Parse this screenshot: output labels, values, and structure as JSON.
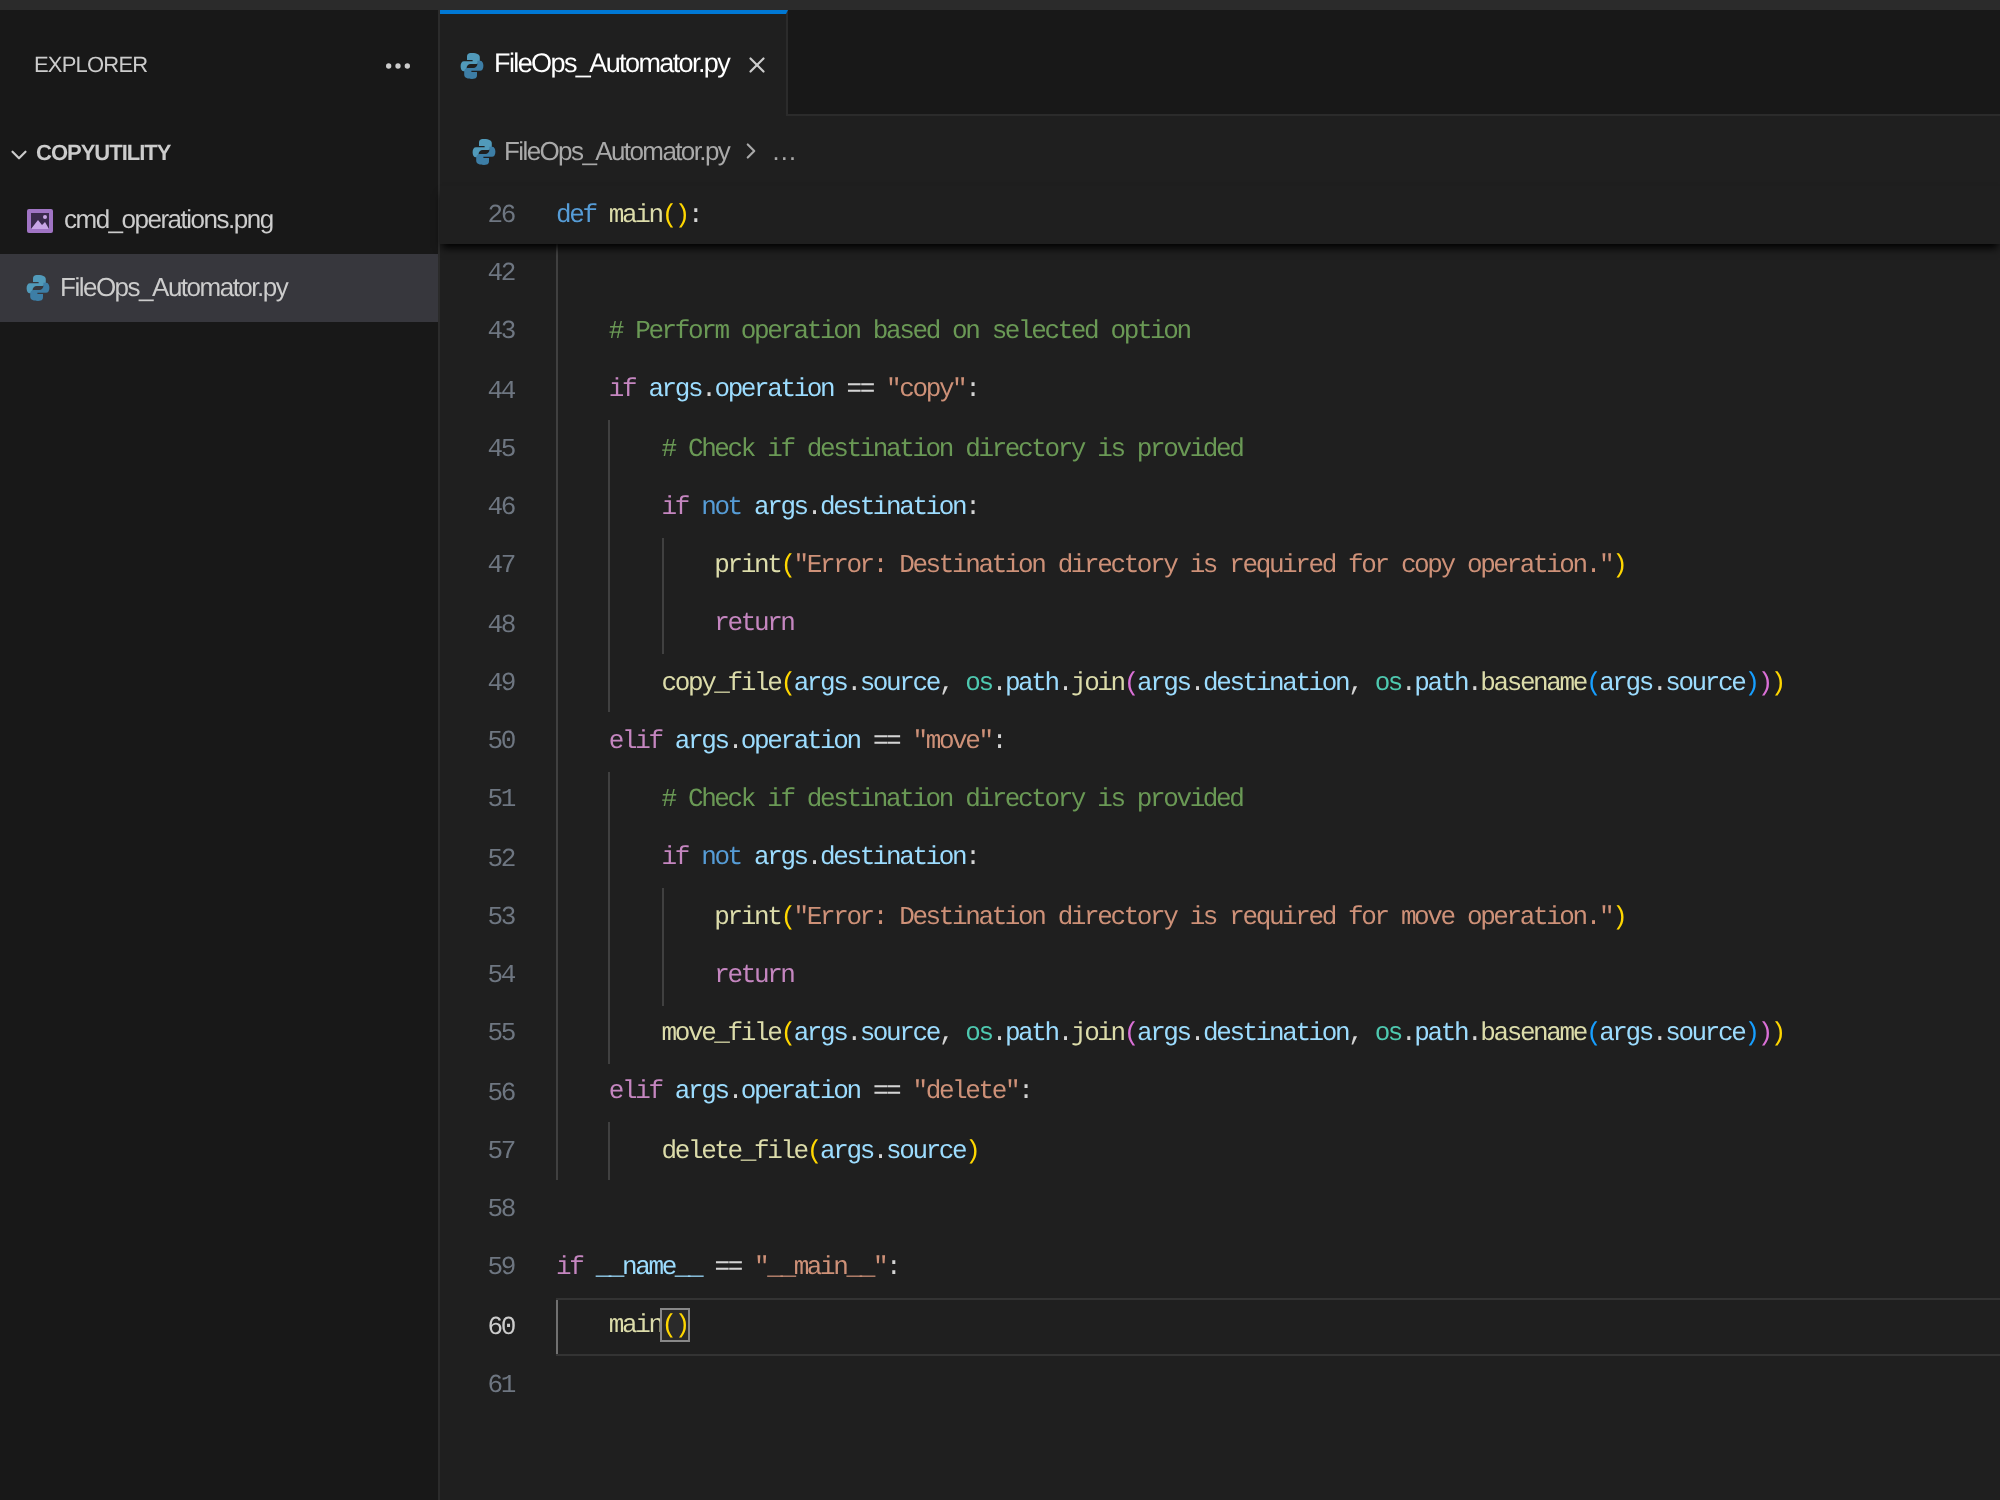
{
  "sidebar": {
    "title": "EXPLORER",
    "folder": {
      "name": "COPYUTILITY",
      "expanded": true,
      "children": [
        {
          "name": "cmd_operations.png",
          "kind": "image",
          "selected": false
        },
        {
          "name": "FileOps_Automator.py",
          "kind": "python",
          "selected": true
        }
      ]
    }
  },
  "tabs": [
    {
      "label": "FileOps_Automator.py",
      "kind": "python",
      "selected": true
    }
  ],
  "breadcrumb": {
    "file": "FileOps_Automator.py",
    "kind": "python",
    "more": "…"
  },
  "editor": {
    "sticky_line": {
      "number": "26",
      "active": false,
      "tokens": [
        {
          "kind": "storage",
          "text": "def "
        },
        {
          "kind": "function",
          "text": "main"
        },
        {
          "kind": "bracket1",
          "text": "()"
        },
        {
          "kind": "plain",
          "text": ":"
        }
      ],
      "children": [
        {
          "number": "42",
          "active": false
        },
        {
          "number": "43",
          "active": false,
          "tokens": [
            {
              "kind": "comment",
              "text": "# Perform operation based on selected option"
            }
          ]
        },
        {
          "number": "44",
          "active": false,
          "tokens": [
            {
              "kind": "keyword",
              "text": "if "
            },
            {
              "kind": "variable",
              "text": "args"
            },
            {
              "kind": "plain",
              "text": "."
            },
            {
              "kind": "variable",
              "text": "operation"
            },
            {
              "kind": "plain",
              "text": " == "
            },
            {
              "kind": "string",
              "text": "\"copy\""
            },
            {
              "kind": "plain",
              "text": ":"
            }
          ],
          "children": [
            {
              "number": "45",
              "active": false,
              "tokens": [
                {
                  "kind": "comment",
                  "text": "# Check if destination directory is provided"
                }
              ]
            },
            {
              "number": "46",
              "active": false,
              "tokens": [
                {
                  "kind": "keyword",
                  "text": "if "
                },
                {
                  "kind": "storage",
                  "text": "not "
                },
                {
                  "kind": "variable",
                  "text": "args"
                },
                {
                  "kind": "plain",
                  "text": "."
                },
                {
                  "kind": "variable",
                  "text": "destination"
                },
                {
                  "kind": "plain",
                  "text": ":"
                }
              ],
              "children": [
                {
                  "number": "47",
                  "active": false,
                  "tokens": [
                    {
                      "kind": "function",
                      "text": "print"
                    },
                    {
                      "kind": "bracket1",
                      "text": "("
                    },
                    {
                      "kind": "string",
                      "text": "\"Error: Destination directory is required for copy operation.\""
                    },
                    {
                      "kind": "bracket1",
                      "text": ")"
                    }
                  ]
                },
                {
                  "number": "48",
                  "active": false,
                  "tokens": [
                    {
                      "kind": "keyword",
                      "text": "return"
                    }
                  ]
                }
              ]
            },
            {
              "number": "49",
              "active": false,
              "tokens": [
                {
                  "kind": "function",
                  "text": "copy_file"
                },
                {
                  "kind": "bracket1",
                  "text": "("
                },
                {
                  "kind": "variable",
                  "text": "args"
                },
                {
                  "kind": "plain",
                  "text": "."
                },
                {
                  "kind": "variable",
                  "text": "source"
                },
                {
                  "kind": "plain",
                  "text": ", "
                },
                {
                  "kind": "module",
                  "text": "os"
                },
                {
                  "kind": "plain",
                  "text": "."
                },
                {
                  "kind": "variable",
                  "text": "path"
                },
                {
                  "kind": "plain",
                  "text": "."
                },
                {
                  "kind": "function",
                  "text": "join"
                },
                {
                  "kind": "bracket2",
                  "text": "("
                },
                {
                  "kind": "variable",
                  "text": "args"
                },
                {
                  "kind": "plain",
                  "text": "."
                },
                {
                  "kind": "variable",
                  "text": "destination"
                },
                {
                  "kind": "plain",
                  "text": ", "
                },
                {
                  "kind": "module",
                  "text": "os"
                },
                {
                  "kind": "plain",
                  "text": "."
                },
                {
                  "kind": "variable",
                  "text": "path"
                },
                {
                  "kind": "plain",
                  "text": "."
                },
                {
                  "kind": "function",
                  "text": "basename"
                },
                {
                  "kind": "bracket3",
                  "text": "("
                },
                {
                  "kind": "variable",
                  "text": "args"
                },
                {
                  "kind": "plain",
                  "text": "."
                },
                {
                  "kind": "variable",
                  "text": "source"
                },
                {
                  "kind": "bracket3",
                  "text": ")"
                },
                {
                  "kind": "bracket2",
                  "text": ")"
                },
                {
                  "kind": "bracket1",
                  "text": ")"
                }
              ]
            }
          ]
        },
        {
          "number": "50",
          "active": false,
          "tokens": [
            {
              "kind": "keyword",
              "text": "elif "
            },
            {
              "kind": "variable",
              "text": "args"
            },
            {
              "kind": "plain",
              "text": "."
            },
            {
              "kind": "variable",
              "text": "operation"
            },
            {
              "kind": "plain",
              "text": " == "
            },
            {
              "kind": "string",
              "text": "\"move\""
            },
            {
              "kind": "plain",
              "text": ":"
            }
          ],
          "children": [
            {
              "number": "51",
              "active": false,
              "tokens": [
                {
                  "kind": "comment",
                  "text": "# Check if destination directory is provided"
                }
              ]
            },
            {
              "number": "52",
              "active": false,
              "tokens": [
                {
                  "kind": "keyword",
                  "text": "if "
                },
                {
                  "kind": "storage",
                  "text": "not "
                },
                {
                  "kind": "variable",
                  "text": "args"
                },
                {
                  "kind": "plain",
                  "text": "."
                },
                {
                  "kind": "variable",
                  "text": "destination"
                },
                {
                  "kind": "plain",
                  "text": ":"
                }
              ],
              "children": [
                {
                  "number": "53",
                  "active": false,
                  "tokens": [
                    {
                      "kind": "function",
                      "text": "print"
                    },
                    {
                      "kind": "bracket1",
                      "text": "("
                    },
                    {
                      "kind": "string",
                      "text": "\"Error: Destination directory is required for move operation.\""
                    },
                    {
                      "kind": "bracket1",
                      "text": ")"
                    }
                  ]
                },
                {
                  "number": "54",
                  "active": false,
                  "tokens": [
                    {
                      "kind": "keyword",
                      "text": "return"
                    }
                  ]
                }
              ]
            },
            {
              "number": "55",
              "active": false,
              "tokens": [
                {
                  "kind": "function",
                  "text": "move_file"
                },
                {
                  "kind": "bracket1",
                  "text": "("
                },
                {
                  "kind": "variable",
                  "text": "args"
                },
                {
                  "kind": "plain",
                  "text": "."
                },
                {
                  "kind": "variable",
                  "text": "source"
                },
                {
                  "kind": "plain",
                  "text": ", "
                },
                {
                  "kind": "module",
                  "text": "os"
                },
                {
                  "kind": "plain",
                  "text": "."
                },
                {
                  "kind": "variable",
                  "text": "path"
                },
                {
                  "kind": "plain",
                  "text": "."
                },
                {
                  "kind": "function",
                  "text": "join"
                },
                {
                  "kind": "bracket2",
                  "text": "("
                },
                {
                  "kind": "variable",
                  "text": "args"
                },
                {
                  "kind": "plain",
                  "text": "."
                },
                {
                  "kind": "variable",
                  "text": "destination"
                },
                {
                  "kind": "plain",
                  "text": ", "
                },
                {
                  "kind": "module",
                  "text": "os"
                },
                {
                  "kind": "plain",
                  "text": "."
                },
                {
                  "kind": "variable",
                  "text": "path"
                },
                {
                  "kind": "plain",
                  "text": "."
                },
                {
                  "kind": "function",
                  "text": "basename"
                },
                {
                  "kind": "bracket3",
                  "text": "("
                },
                {
                  "kind": "variable",
                  "text": "args"
                },
                {
                  "kind": "plain",
                  "text": "."
                },
                {
                  "kind": "variable",
                  "text": "source"
                },
                {
                  "kind": "bracket3",
                  "text": ")"
                },
                {
                  "kind": "bracket2",
                  "text": ")"
                },
                {
                  "kind": "bracket1",
                  "text": ")"
                }
              ]
            }
          ]
        },
        {
          "number": "56",
          "active": false,
          "tokens": [
            {
              "kind": "keyword",
              "text": "elif "
            },
            {
              "kind": "variable",
              "text": "args"
            },
            {
              "kind": "plain",
              "text": "."
            },
            {
              "kind": "variable",
              "text": "operation"
            },
            {
              "kind": "plain",
              "text": " == "
            },
            {
              "kind": "string",
              "text": "\"delete\""
            },
            {
              "kind": "plain",
              "text": ":"
            }
          ],
          "children": [
            {
              "number": "57",
              "active": false,
              "tokens": [
                {
                  "kind": "function",
                  "text": "delete_file"
                },
                {
                  "kind": "bracket1",
                  "text": "("
                },
                {
                  "kind": "variable",
                  "text": "args"
                },
                {
                  "kind": "plain",
                  "text": "."
                },
                {
                  "kind": "variable",
                  "text": "source"
                },
                {
                  "kind": "bracket1",
                  "text": ")"
                }
              ]
            }
          ]
        }
      ]
    },
    "lines": [
      {
        "number": "58",
        "active": false
      },
      {
        "number": "59",
        "active": false,
        "tokens": [
          {
            "kind": "keyword",
            "text": "if "
          },
          {
            "kind": "variable",
            "text": "__name__"
          },
          {
            "kind": "plain",
            "text": " == "
          },
          {
            "kind": "string",
            "text": "\"__main__\""
          },
          {
            "kind": "plain",
            "text": ":"
          }
        ],
        "children": [
          {
            "number": "60",
            "active": true,
            "tokens": [
              {
                "kind": "function",
                "text": "main"
              },
              {
                "kind": "bracket1",
                "text": "()",
                "matched": true
              }
            ]
          }
        ]
      },
      {
        "number": "61",
        "active": false
      }
    ]
  }
}
